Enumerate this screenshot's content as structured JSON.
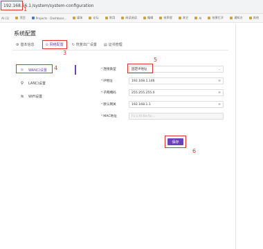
{
  "browser": {
    "url_host": "192.168.66.1",
    "url_path": "/system/system-configuration",
    "bookmarks": [
      "AI (1)",
      "项目",
      "Projects · Dashboar...",
      "媒体",
      "论坛",
      "常用",
      "阅读阅读",
      "编辑",
      "效率提",
      "其它",
      "AI",
      "效果打开",
      "通知方",
      "其他"
    ]
  },
  "annotations": [
    "1",
    "2",
    "3",
    "4",
    "5",
    "6"
  ],
  "page": {
    "title": "系统配置",
    "tabs": [
      {
        "label": "基本信息",
        "icon": "⚙"
      },
      {
        "label": "网络配置",
        "icon": "⊙"
      },
      {
        "label": "恢复出厂设置",
        "icon": "↻"
      },
      {
        "label": "证书管理",
        "icon": "▤"
      }
    ],
    "nav": [
      {
        "label": "WAN口设置",
        "icon": "☼"
      },
      {
        "label": "LAN口设置",
        "icon": "⚲"
      },
      {
        "label": "WiFi设置",
        "icon": "≋"
      }
    ],
    "form": {
      "connection_type_label": "连接类型",
      "connection_type_value": "固定IP地址",
      "ip_label": "IP地址",
      "ip_value": "192.168.1.146",
      "mask_label": "子网掩码",
      "mask_value": "255.255.255.0",
      "gateway_label": "默认网关",
      "gateway_value": "192.168.1.1",
      "mac_label": "MAC地址",
      "mac_value": "Fc:c:fd:8e:fa:..."
    },
    "save_label": "保存"
  }
}
